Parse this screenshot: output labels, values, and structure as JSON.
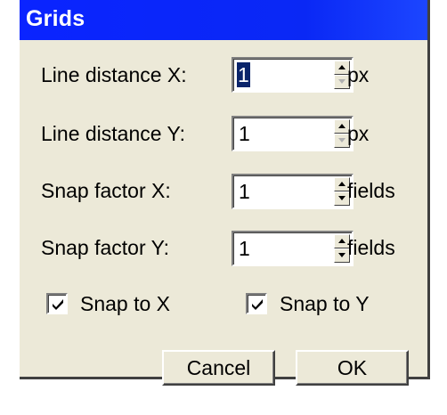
{
  "dialog": {
    "title": "Grids"
  },
  "fields": [
    {
      "label": "Line distance X:",
      "value": "1",
      "unit": "px",
      "selected": true,
      "down_disabled": true
    },
    {
      "label": "Line distance Y:",
      "value": "1",
      "unit": "px",
      "selected": false,
      "down_disabled": true
    },
    {
      "label": "Snap factor X:",
      "value": "1",
      "unit": "fields",
      "selected": false,
      "down_disabled": false
    },
    {
      "label": "Snap factor Y:",
      "value": "1",
      "unit": "fields",
      "selected": false,
      "down_disabled": false
    }
  ],
  "checkboxes": [
    {
      "label": "Snap to X",
      "checked": true
    },
    {
      "label": "Snap to Y",
      "checked": true
    }
  ],
  "buttons": {
    "cancel_label": "Cancel",
    "ok_label": "OK"
  },
  "colors": {
    "titlebar": "#0a24ff",
    "dialog_bg": "#ece9d8",
    "selection_bg": "#0a246a"
  },
  "icons": {
    "spin_up": "triangle-up",
    "spin_down": "triangle-down",
    "check": "checkmark"
  }
}
